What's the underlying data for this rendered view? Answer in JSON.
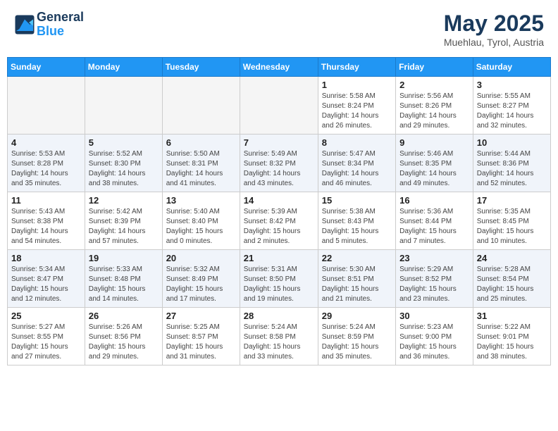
{
  "header": {
    "logo_line1": "General",
    "logo_line2": "Blue",
    "month_year": "May 2025",
    "location": "Muehlau, Tyrol, Austria"
  },
  "days_of_week": [
    "Sunday",
    "Monday",
    "Tuesday",
    "Wednesday",
    "Thursday",
    "Friday",
    "Saturday"
  ],
  "weeks": [
    [
      {
        "day": "",
        "info": ""
      },
      {
        "day": "",
        "info": ""
      },
      {
        "day": "",
        "info": ""
      },
      {
        "day": "",
        "info": ""
      },
      {
        "day": "1",
        "info": "Sunrise: 5:58 AM\nSunset: 8:24 PM\nDaylight: 14 hours and 26 minutes."
      },
      {
        "day": "2",
        "info": "Sunrise: 5:56 AM\nSunset: 8:26 PM\nDaylight: 14 hours and 29 minutes."
      },
      {
        "day": "3",
        "info": "Sunrise: 5:55 AM\nSunset: 8:27 PM\nDaylight: 14 hours and 32 minutes."
      }
    ],
    [
      {
        "day": "4",
        "info": "Sunrise: 5:53 AM\nSunset: 8:28 PM\nDaylight: 14 hours and 35 minutes."
      },
      {
        "day": "5",
        "info": "Sunrise: 5:52 AM\nSunset: 8:30 PM\nDaylight: 14 hours and 38 minutes."
      },
      {
        "day": "6",
        "info": "Sunrise: 5:50 AM\nSunset: 8:31 PM\nDaylight: 14 hours and 41 minutes."
      },
      {
        "day": "7",
        "info": "Sunrise: 5:49 AM\nSunset: 8:32 PM\nDaylight: 14 hours and 43 minutes."
      },
      {
        "day": "8",
        "info": "Sunrise: 5:47 AM\nSunset: 8:34 PM\nDaylight: 14 hours and 46 minutes."
      },
      {
        "day": "9",
        "info": "Sunrise: 5:46 AM\nSunset: 8:35 PM\nDaylight: 14 hours and 49 minutes."
      },
      {
        "day": "10",
        "info": "Sunrise: 5:44 AM\nSunset: 8:36 PM\nDaylight: 14 hours and 52 minutes."
      }
    ],
    [
      {
        "day": "11",
        "info": "Sunrise: 5:43 AM\nSunset: 8:38 PM\nDaylight: 14 hours and 54 minutes."
      },
      {
        "day": "12",
        "info": "Sunrise: 5:42 AM\nSunset: 8:39 PM\nDaylight: 14 hours and 57 minutes."
      },
      {
        "day": "13",
        "info": "Sunrise: 5:40 AM\nSunset: 8:40 PM\nDaylight: 15 hours and 0 minutes."
      },
      {
        "day": "14",
        "info": "Sunrise: 5:39 AM\nSunset: 8:42 PM\nDaylight: 15 hours and 2 minutes."
      },
      {
        "day": "15",
        "info": "Sunrise: 5:38 AM\nSunset: 8:43 PM\nDaylight: 15 hours and 5 minutes."
      },
      {
        "day": "16",
        "info": "Sunrise: 5:36 AM\nSunset: 8:44 PM\nDaylight: 15 hours and 7 minutes."
      },
      {
        "day": "17",
        "info": "Sunrise: 5:35 AM\nSunset: 8:45 PM\nDaylight: 15 hours and 10 minutes."
      }
    ],
    [
      {
        "day": "18",
        "info": "Sunrise: 5:34 AM\nSunset: 8:47 PM\nDaylight: 15 hours and 12 minutes."
      },
      {
        "day": "19",
        "info": "Sunrise: 5:33 AM\nSunset: 8:48 PM\nDaylight: 15 hours and 14 minutes."
      },
      {
        "day": "20",
        "info": "Sunrise: 5:32 AM\nSunset: 8:49 PM\nDaylight: 15 hours and 17 minutes."
      },
      {
        "day": "21",
        "info": "Sunrise: 5:31 AM\nSunset: 8:50 PM\nDaylight: 15 hours and 19 minutes."
      },
      {
        "day": "22",
        "info": "Sunrise: 5:30 AM\nSunset: 8:51 PM\nDaylight: 15 hours and 21 minutes."
      },
      {
        "day": "23",
        "info": "Sunrise: 5:29 AM\nSunset: 8:52 PM\nDaylight: 15 hours and 23 minutes."
      },
      {
        "day": "24",
        "info": "Sunrise: 5:28 AM\nSunset: 8:54 PM\nDaylight: 15 hours and 25 minutes."
      }
    ],
    [
      {
        "day": "25",
        "info": "Sunrise: 5:27 AM\nSunset: 8:55 PM\nDaylight: 15 hours and 27 minutes."
      },
      {
        "day": "26",
        "info": "Sunrise: 5:26 AM\nSunset: 8:56 PM\nDaylight: 15 hours and 29 minutes."
      },
      {
        "day": "27",
        "info": "Sunrise: 5:25 AM\nSunset: 8:57 PM\nDaylight: 15 hours and 31 minutes."
      },
      {
        "day": "28",
        "info": "Sunrise: 5:24 AM\nSunset: 8:58 PM\nDaylight: 15 hours and 33 minutes."
      },
      {
        "day": "29",
        "info": "Sunrise: 5:24 AM\nSunset: 8:59 PM\nDaylight: 15 hours and 35 minutes."
      },
      {
        "day": "30",
        "info": "Sunrise: 5:23 AM\nSunset: 9:00 PM\nDaylight: 15 hours and 36 minutes."
      },
      {
        "day": "31",
        "info": "Sunrise: 5:22 AM\nSunset: 9:01 PM\nDaylight: 15 hours and 38 minutes."
      }
    ]
  ]
}
